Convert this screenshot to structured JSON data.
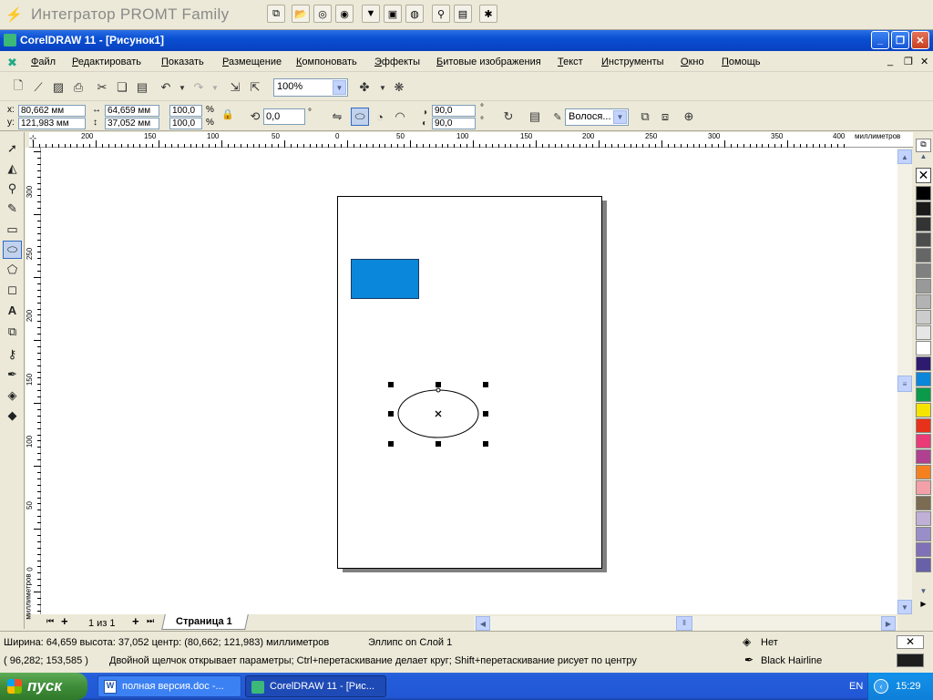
{
  "promt_bar": {
    "title": "Интегратор PROMT Family"
  },
  "window": {
    "title": "CorelDRAW 11 - [Рисунок1]"
  },
  "menu": {
    "items": [
      "Файл",
      "Редактировать",
      "Показать",
      "Размещение",
      "Компоновать",
      "Эффекты",
      "Битовые изображения",
      "Текст",
      "Инструменты",
      "Окно",
      "Помощь"
    ]
  },
  "toolbar": {
    "zoom_value": "100%"
  },
  "property_bar": {
    "x_label": "x:",
    "x_value": "80,662 мм",
    "y_label": "y:",
    "y_value": "121,983 мм",
    "width_value": "64,659 мм",
    "height_value": "37,052 мм",
    "scale_x": "100,0",
    "scale_y": "100,0",
    "percent": "%",
    "rotation": "0,0",
    "degree": "°",
    "start_angle": "90,0",
    "end_angle": "90,0",
    "outline_width": "Волося..."
  },
  "rulers": {
    "h_unit": "миллиметров",
    "v_unit": "миллиметров",
    "h_labels": [
      "200",
      "150",
      "100",
      "50",
      "0",
      "50",
      "100",
      "150",
      "200",
      "250",
      "300",
      "350",
      "400"
    ],
    "v_labels": [
      "300",
      "250",
      "200",
      "150",
      "100",
      "50",
      "0"
    ]
  },
  "pages": {
    "counter": "1 из 1",
    "tab_label": "Страница 1"
  },
  "status": {
    "dimensions": "Ширина: 64,659  высота: 37,052  центр: (80,662; 121,983)  миллиметров",
    "object_info": "Эллипс on Слой 1",
    "cursor_pos": "( 96,282; 153,585 )",
    "hint": "Двойной щелчок открывает параметры; Ctrl+перетаскивание делает круг; Shift+перетаскивание рисует по  центру",
    "fill_label": "Нет",
    "outline_label": "Black  Hairline"
  },
  "taskbar": {
    "start_label": "пуск",
    "tasks": [
      "полная версия.doc -...",
      "CorelDRAW 11 - [Рис..."
    ],
    "lang": "EN",
    "clock": "15:29"
  },
  "colors": {
    "rectangle_fill": "#0a87da",
    "palette": [
      "#000000",
      "#1a1a1a",
      "#333333",
      "#4d4d4d",
      "#666666",
      "#808080",
      "#999999",
      "#b3b3b3",
      "#cccccc",
      "#e6e6e6",
      "#ffffff",
      "#2e1a6e",
      "#0a87da",
      "#0a9a49",
      "#f5e400",
      "#e8311a",
      "#ea3a78",
      "#b04090",
      "#f58020",
      "#f4a0a8",
      "#7a6b52",
      "#c0b0d8",
      "#9a8ec8",
      "#8070b8",
      "#6860a8"
    ]
  }
}
